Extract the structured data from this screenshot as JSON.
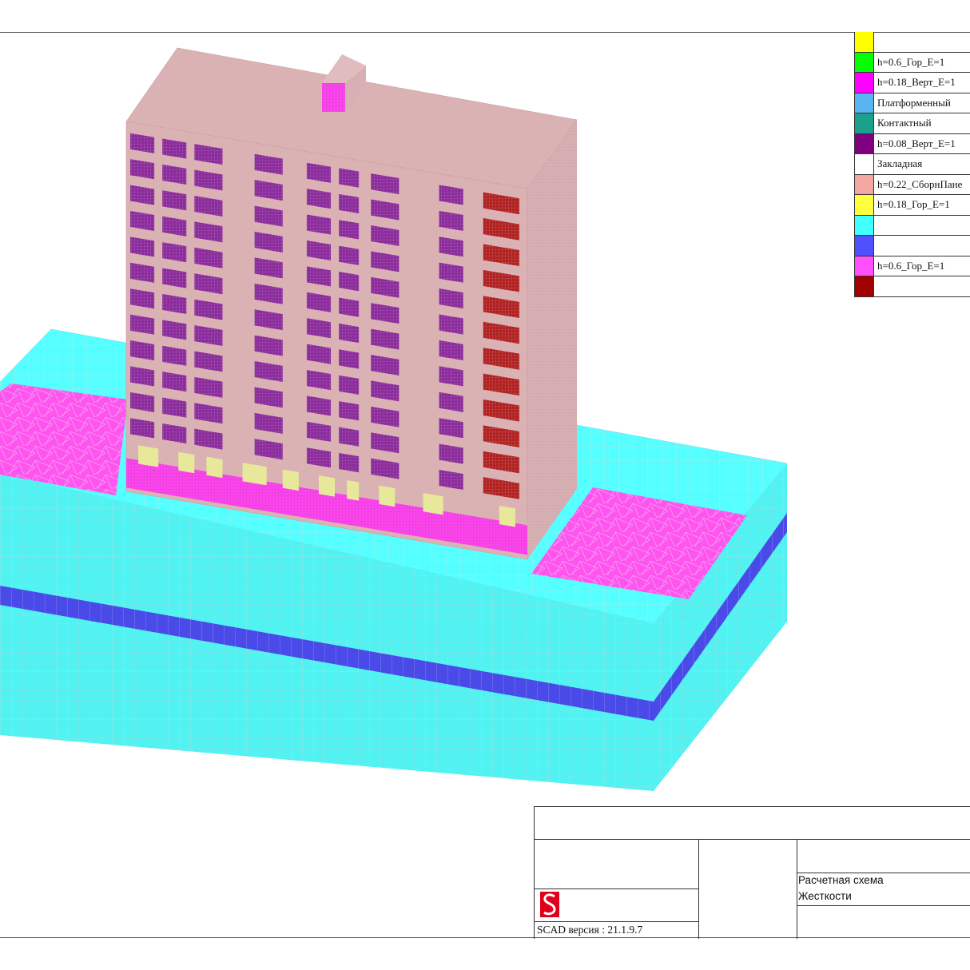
{
  "legend": {
    "items": [
      {
        "color": "#ffff00",
        "label": ""
      },
      {
        "color": "#00ff00",
        "label": "h=0.6_Гор_E=1"
      },
      {
        "color": "#ff00ff",
        "label": "h=0.18_Верт_E=1"
      },
      {
        "color": "#5ab4f0",
        "label": "Платформенный"
      },
      {
        "color": "#1aa08c",
        "label": "Контактный"
      },
      {
        "color": "#800080",
        "label": "h=0.08_Верт_E=1"
      },
      {
        "color": "#ffffff",
        "label": "Закладная"
      },
      {
        "color": "#f4a6a0",
        "label": "h=0.22_СборнПане"
      },
      {
        "color": "#ffff40",
        "label": "h=0.18_Гор_E=1"
      },
      {
        "color": "#40ffff",
        "label": ""
      },
      {
        "color": "#5050ff",
        "label": ""
      },
      {
        "color": "#ff50ff",
        "label": "h=0.6_Гор_E=1"
      },
      {
        "color": "#a00000",
        "label": ""
      }
    ]
  },
  "title_block": {
    "scheme_label": "Расчетная схема",
    "scheme_name": "Жесткости",
    "version": "SCAD версия : 21.1.9.7"
  },
  "colors": {
    "soil": "#55ffff",
    "soil_layer": "#5050ee",
    "slab": "#ff55ee",
    "wall": "#dbb2b4",
    "window_purple": "#8a2a9a",
    "window_red": "#b02020",
    "base_yellow": "#e8e89a"
  }
}
